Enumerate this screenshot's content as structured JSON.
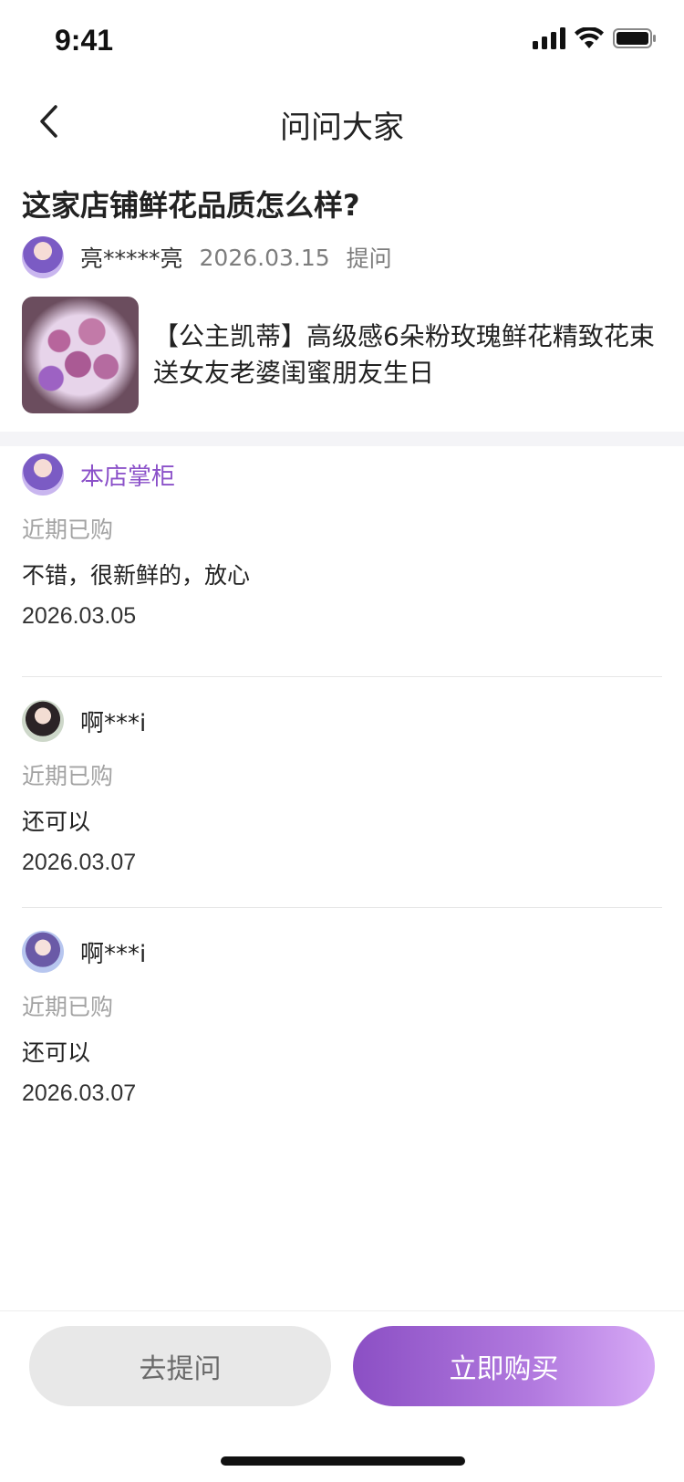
{
  "status_bar": {
    "time": "9:41"
  },
  "nav": {
    "title": "问问大家"
  },
  "question": {
    "title": "这家店铺鲜花品质怎么样?",
    "asker_name": "亮*****亮",
    "date": "2026.03.15",
    "action": "提问"
  },
  "product": {
    "name": "【公主凯蒂】高级感6朵粉玫瑰鲜花精致花束送女友老婆闺蜜朋友生日"
  },
  "answers": [
    {
      "name": "本店掌柜",
      "tag": "近期已购",
      "text": "不错，很新鲜的，放心",
      "date": "2026.03.05"
    },
    {
      "name": "啊***i",
      "tag": "近期已购",
      "text": "还可以",
      "date": "2026.03.07"
    },
    {
      "name": "啊***i",
      "tag": "近期已购",
      "text": "还可以",
      "date": "2026.03.07"
    }
  ],
  "bottom_bar": {
    "ask_label": "去提问",
    "buy_label": "立即购买"
  },
  "colors": {
    "accent": "#8b51c9",
    "section_bg": "#f4f4f7",
    "muted_text": "#a3a3a3"
  }
}
